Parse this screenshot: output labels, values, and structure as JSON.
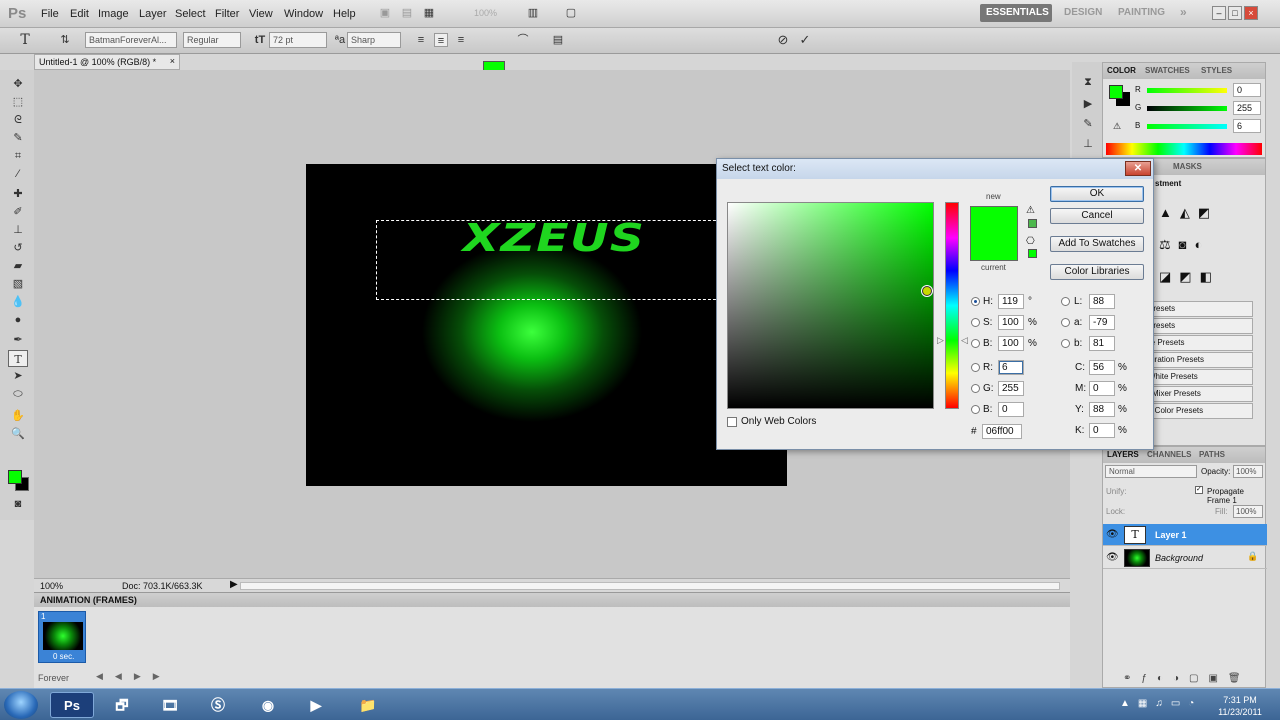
{
  "app": {
    "logo": "Ps"
  },
  "menu": [
    "File",
    "Edit",
    "Image",
    "Layer",
    "Select",
    "Filter",
    "View",
    "Window",
    "Help"
  ],
  "zoom_display": "100%",
  "workspaces": {
    "essentials": "ESSENTIALS",
    "design": "DESIGN",
    "painting": "PAINTING",
    "more": "»"
  },
  "window_controls": {
    "minimize": "–",
    "maximize": "□",
    "close": "×"
  },
  "options": {
    "font_family": "BatmanForeverAl...",
    "font_style": "Regular",
    "font_size": "72 pt",
    "antialias": "Sharp",
    "text_color": "#06ff00"
  },
  "document": {
    "tab_title": "Untitled-1 @ 100% (RGB/8) *",
    "art_text": "XZEUS",
    "zoom": "100%",
    "doc_info": "Doc: 703.1K/663.3K"
  },
  "animation": {
    "title": "ANIMATION (FRAMES)",
    "frame_number": "1",
    "frame_delay": "0 sec.",
    "loop": "Forever"
  },
  "color_panel": {
    "tabs": [
      "COLOR",
      "SWATCHES",
      "STYLES"
    ],
    "channels": [
      {
        "label": "R",
        "value": "0"
      },
      {
        "label": "G",
        "value": "255"
      },
      {
        "label": "B",
        "value": "6"
      }
    ]
  },
  "adjust_panel": {
    "tabs": [
      "MASKS"
    ],
    "header": "stment",
    "presets": [
      "Presets",
      "Presets",
      "re Presets",
      "turation Presets",
      "White Presets",
      "l Mixer Presets",
      "a Color Presets"
    ]
  },
  "layers_panel": {
    "tabs": [
      "LAYERS",
      "CHANNELS",
      "PATHS"
    ],
    "blend_mode": "Normal",
    "opacity_label": "Opacity:",
    "opacity": "100%",
    "unify_label": "Unify:",
    "propagate": "Propagate Frame 1",
    "lock_label": "Lock:",
    "fill_label": "Fill:",
    "fill": "100%",
    "layers": [
      {
        "name": "Layer 1",
        "type": "text"
      },
      {
        "name": "Background",
        "type": "image"
      }
    ]
  },
  "dialog": {
    "title": "Select text color:",
    "new_label": "new",
    "current_label": "current",
    "ok": "OK",
    "cancel": "Cancel",
    "add_swatches": "Add To Swatches",
    "color_libraries": "Color Libraries",
    "only_web_colors": "Only Web Colors",
    "hsb": [
      {
        "label": "H:",
        "value": "119",
        "unit": "°"
      },
      {
        "label": "S:",
        "value": "100",
        "unit": "%"
      },
      {
        "label": "B:",
        "value": "100",
        "unit": "%"
      }
    ],
    "rgb": [
      {
        "label": "R:",
        "value": "6"
      },
      {
        "label": "G:",
        "value": "255"
      },
      {
        "label": "B:",
        "value": "0"
      }
    ],
    "lab": [
      {
        "label": "L:",
        "value": "88"
      },
      {
        "label": "a:",
        "value": "-79"
      },
      {
        "label": "b:",
        "value": "81"
      }
    ],
    "cmyk": [
      {
        "label": "C:",
        "value": "56",
        "unit": "%"
      },
      {
        "label": "M:",
        "value": "0",
        "unit": "%"
      },
      {
        "label": "Y:",
        "value": "88",
        "unit": "%"
      },
      {
        "label": "K:",
        "value": "0",
        "unit": "%"
      }
    ],
    "hex_label": "#",
    "hex": "06ff00"
  },
  "taskbar": {
    "apps": [
      "Ps",
      "Explorer",
      "Media",
      "Skype",
      "Chrome",
      "Player",
      "Folder"
    ],
    "time": "7:31 PM",
    "date": "11/23/2011"
  }
}
